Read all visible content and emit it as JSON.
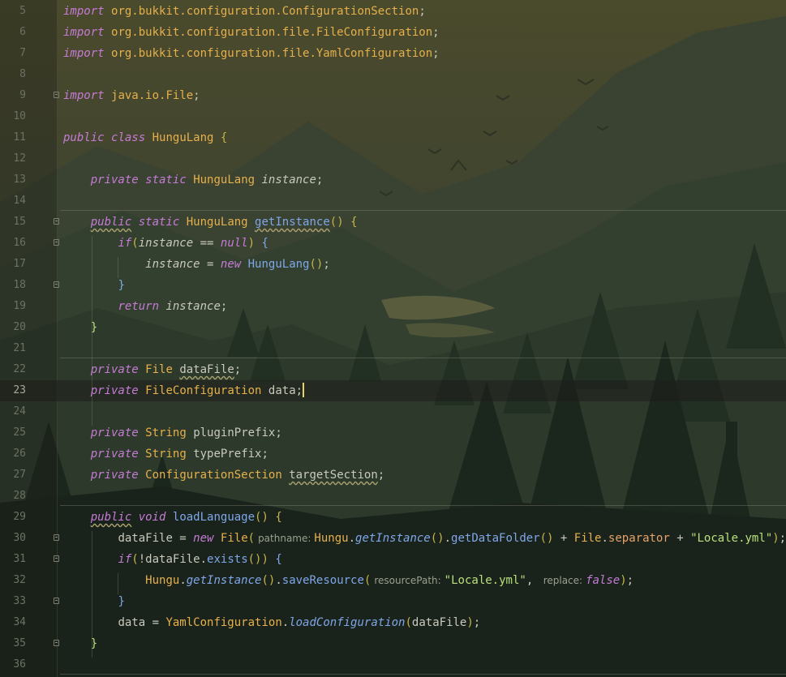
{
  "editor": {
    "current_line": "23",
    "lines": [
      {
        "n": "5",
        "tokens": [
          [
            "kw",
            "import"
          ],
          [
            "punc",
            " "
          ],
          [
            "pkg",
            "org.bukkit.configuration.ConfigurationSection"
          ],
          [
            "punc",
            ";"
          ]
        ]
      },
      {
        "n": "6",
        "tokens": [
          [
            "kw",
            "import"
          ],
          [
            "punc",
            " "
          ],
          [
            "pkg",
            "org.bukkit.configuration.file.FileConfiguration"
          ],
          [
            "punc",
            ";"
          ]
        ]
      },
      {
        "n": "7",
        "tokens": [
          [
            "kw",
            "import"
          ],
          [
            "punc",
            " "
          ],
          [
            "pkg",
            "org.bukkit.configuration.file.YamlConfiguration"
          ],
          [
            "punc",
            ";"
          ]
        ]
      },
      {
        "n": "8",
        "tokens": []
      },
      {
        "n": "9",
        "tokens": [
          [
            "kw",
            "import"
          ],
          [
            "punc",
            " "
          ],
          [
            "pkg",
            "java.io.File"
          ],
          [
            "punc",
            ";"
          ]
        ]
      },
      {
        "n": "10",
        "tokens": []
      },
      {
        "n": "11",
        "tokens": [
          [
            "kw",
            "public"
          ],
          [
            "punc",
            " "
          ],
          [
            "kw",
            "class"
          ],
          [
            "punc",
            " "
          ],
          [
            "ty",
            "HunguLang"
          ],
          [
            "punc",
            " "
          ],
          [
            "br",
            "{"
          ]
        ]
      },
      {
        "n": "12",
        "tokens": []
      },
      {
        "n": "13",
        "tokens": [
          [
            "punc",
            "    "
          ],
          [
            "kw",
            "private"
          ],
          [
            "punc",
            " "
          ],
          [
            "kw",
            "static"
          ],
          [
            "punc",
            " "
          ],
          [
            "ty",
            "HunguLang"
          ],
          [
            "punc",
            " "
          ],
          [
            "id it",
            "instance"
          ],
          [
            "punc",
            ";"
          ]
        ]
      },
      {
        "n": "14",
        "tokens": []
      },
      {
        "n": "15",
        "tokens": [
          [
            "punc",
            "    "
          ],
          [
            "kw wavy",
            "public"
          ],
          [
            "punc",
            " "
          ],
          [
            "kw",
            "static"
          ],
          [
            "punc",
            " "
          ],
          [
            "ty",
            "HunguLang"
          ],
          [
            "punc",
            " "
          ],
          [
            "fn wavy",
            "getInstance"
          ],
          [
            "br",
            "()"
          ],
          [
            "punc",
            " "
          ],
          [
            "br",
            "{"
          ]
        ]
      },
      {
        "n": "16",
        "tokens": [
          [
            "punc",
            "        "
          ],
          [
            "kw",
            "if"
          ],
          [
            "br",
            "("
          ],
          [
            "id it",
            "instance"
          ],
          [
            "punc",
            " == "
          ],
          [
            "bv",
            "null"
          ],
          [
            "br",
            ")"
          ],
          [
            "punc",
            " "
          ],
          [
            "fn",
            "{"
          ]
        ]
      },
      {
        "n": "17",
        "tokens": [
          [
            "punc",
            "            "
          ],
          [
            "id it",
            "instance"
          ],
          [
            "punc",
            " = "
          ],
          [
            "kw",
            "new"
          ],
          [
            "punc",
            " "
          ],
          [
            "fn",
            "HunguLang"
          ],
          [
            "br",
            "()"
          ],
          [
            "punc",
            ";"
          ]
        ]
      },
      {
        "n": "18",
        "tokens": [
          [
            "punc",
            "        "
          ],
          [
            "fn",
            "}"
          ]
        ]
      },
      {
        "n": "19",
        "tokens": [
          [
            "punc",
            "        "
          ],
          [
            "kw",
            "return"
          ],
          [
            "punc",
            " "
          ],
          [
            "id it",
            "instance"
          ],
          [
            "punc",
            ";"
          ]
        ]
      },
      {
        "n": "20",
        "tokens": [
          [
            "punc",
            "    "
          ],
          [
            "str",
            "}"
          ]
        ]
      },
      {
        "n": "21",
        "tokens": []
      },
      {
        "n": "22",
        "tokens": [
          [
            "punc",
            "    "
          ],
          [
            "kw",
            "private"
          ],
          [
            "punc",
            " "
          ],
          [
            "ty",
            "File"
          ],
          [
            "punc",
            " "
          ],
          [
            "id wavy",
            "dataFile"
          ],
          [
            "punc",
            ";"
          ]
        ]
      },
      {
        "n": "23",
        "tokens": [
          [
            "punc",
            "    "
          ],
          [
            "kw",
            "private"
          ],
          [
            "punc",
            " "
          ],
          [
            "ty",
            "FileConfiguration"
          ],
          [
            "punc",
            " "
          ],
          [
            "id",
            "data"
          ],
          [
            "punc",
            ";"
          ],
          [
            "caret",
            ""
          ]
        ]
      },
      {
        "n": "24",
        "tokens": []
      },
      {
        "n": "25",
        "tokens": [
          [
            "punc",
            "    "
          ],
          [
            "kw",
            "private"
          ],
          [
            "punc",
            " "
          ],
          [
            "ty",
            "String"
          ],
          [
            "punc",
            " "
          ],
          [
            "id",
            "pluginPrefix"
          ],
          [
            "punc",
            ";"
          ]
        ]
      },
      {
        "n": "26",
        "tokens": [
          [
            "punc",
            "    "
          ],
          [
            "kw",
            "private"
          ],
          [
            "punc",
            " "
          ],
          [
            "ty",
            "String"
          ],
          [
            "punc",
            " "
          ],
          [
            "id",
            "typePrefix"
          ],
          [
            "punc",
            ";"
          ]
        ]
      },
      {
        "n": "27",
        "tokens": [
          [
            "punc",
            "    "
          ],
          [
            "kw",
            "private"
          ],
          [
            "punc",
            " "
          ],
          [
            "ty",
            "ConfigurationSection"
          ],
          [
            "punc",
            " "
          ],
          [
            "id wavy",
            "targetSection"
          ],
          [
            "punc",
            ";"
          ]
        ]
      },
      {
        "n": "28",
        "tokens": []
      },
      {
        "n": "29",
        "tokens": [
          [
            "punc",
            "    "
          ],
          [
            "kw wavy",
            "public"
          ],
          [
            "punc",
            " "
          ],
          [
            "kw",
            "void"
          ],
          [
            "punc",
            " "
          ],
          [
            "fn",
            "loadLanguage"
          ],
          [
            "br",
            "()"
          ],
          [
            "punc",
            " "
          ],
          [
            "br",
            "{"
          ]
        ]
      },
      {
        "n": "30",
        "tokens": [
          [
            "punc",
            "        "
          ],
          [
            "id",
            "dataFile"
          ],
          [
            "punc",
            " = "
          ],
          [
            "kw",
            "new"
          ],
          [
            "punc",
            " "
          ],
          [
            "ty",
            "File"
          ],
          [
            "br",
            "("
          ],
          [
            "hint",
            "pathname:"
          ],
          [
            "ty",
            "Hungu"
          ],
          [
            "punc",
            "."
          ],
          [
            "fn it",
            "getInstance"
          ],
          [
            "br",
            "()"
          ],
          [
            "punc",
            "."
          ],
          [
            "fn",
            "getDataFolder"
          ],
          [
            "br",
            "()"
          ],
          [
            "punc",
            " + "
          ],
          [
            "ty",
            "File"
          ],
          [
            "punc",
            "."
          ],
          [
            "sf",
            "separator"
          ],
          [
            "punc",
            " + "
          ],
          [
            "str",
            "\"Locale.yml\""
          ],
          [
            "br",
            ")"
          ],
          [
            "punc",
            ";"
          ]
        ]
      },
      {
        "n": "31",
        "tokens": [
          [
            "punc",
            "        "
          ],
          [
            "kw",
            "if"
          ],
          [
            "br",
            "("
          ],
          [
            "punc",
            "!"
          ],
          [
            "id",
            "dataFile"
          ],
          [
            "punc",
            "."
          ],
          [
            "fn",
            "exists"
          ],
          [
            "br",
            "()"
          ],
          [
            "br",
            ")"
          ],
          [
            "punc",
            " "
          ],
          [
            "fn",
            "{"
          ]
        ]
      },
      {
        "n": "32",
        "tokens": [
          [
            "punc",
            "            "
          ],
          [
            "ty",
            "Hungu"
          ],
          [
            "punc",
            "."
          ],
          [
            "fn it",
            "getInstance"
          ],
          [
            "br",
            "()"
          ],
          [
            "punc",
            "."
          ],
          [
            "fn",
            "saveResource"
          ],
          [
            "br",
            "("
          ],
          [
            "hint",
            "resourcePath:"
          ],
          [
            "str",
            "\"Locale.yml\""
          ],
          [
            "punc",
            ", "
          ],
          [
            "hint",
            "replace:"
          ],
          [
            "bv",
            "false"
          ],
          [
            "br",
            ")"
          ],
          [
            "punc",
            ";"
          ]
        ]
      },
      {
        "n": "33",
        "tokens": [
          [
            "punc",
            "        "
          ],
          [
            "fn",
            "}"
          ]
        ]
      },
      {
        "n": "34",
        "tokens": [
          [
            "punc",
            "        "
          ],
          [
            "id",
            "data"
          ],
          [
            "punc",
            " = "
          ],
          [
            "ty",
            "YamlConfiguration"
          ],
          [
            "punc",
            "."
          ],
          [
            "fn it",
            "loadConfiguration"
          ],
          [
            "br",
            "("
          ],
          [
            "id",
            "dataFile"
          ],
          [
            "br",
            ")"
          ],
          [
            "punc",
            ";"
          ]
        ]
      },
      {
        "n": "35",
        "tokens": [
          [
            "punc",
            "    "
          ],
          [
            "str",
            "}"
          ]
        ]
      },
      {
        "n": "36",
        "tokens": []
      }
    ]
  }
}
